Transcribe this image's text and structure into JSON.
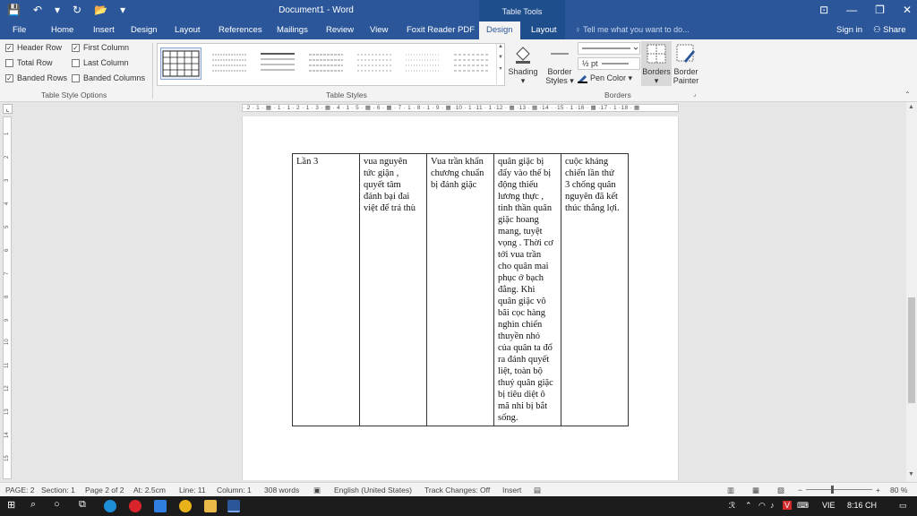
{
  "window": {
    "title": "Document1 - Word",
    "context_header": "Table Tools",
    "qat": [
      "💾",
      "↶",
      "▾",
      "↻",
      "📂",
      "▾"
    ],
    "controls": [
      "⊡",
      "—",
      "❐",
      "✕"
    ]
  },
  "tabs": [
    "File",
    "Home",
    "Insert",
    "Design",
    "Layout",
    "References",
    "Mailings",
    "Review",
    "View",
    "Foxit Reader PDF",
    "Design",
    "Layout"
  ],
  "active_tab_index": 10,
  "tell_me": "Tell me what you want to do...",
  "signin": "Sign in",
  "share": "Share",
  "style_options": {
    "items": [
      {
        "label": "Header Row",
        "checked": true
      },
      {
        "label": "First Column",
        "checked": true
      },
      {
        "label": "Total Row",
        "checked": false
      },
      {
        "label": "Last Column",
        "checked": false
      },
      {
        "label": "Banded Rows",
        "checked": true
      },
      {
        "label": "Banded Columns",
        "checked": false
      }
    ],
    "group_label": "Table Style Options"
  },
  "table_styles": {
    "group_label": "Table Styles"
  },
  "shading": {
    "label1": "Shading",
    "label2": "▾"
  },
  "border_styles": {
    "label1": "Border",
    "label2": "Styles ▾"
  },
  "pen_weight": "½ pt",
  "pen_color": "Pen Color ▾",
  "borders_btn": {
    "label1": "Borders",
    "label2": "▾"
  },
  "border_painter": {
    "label1": "Border",
    "label2": "Painter"
  },
  "borders_group_label": "Borders",
  "ruler_text": "· 2 · 1 · ▦ · 1 · 1 · 2 · 1 · 3 · ▦ · 4 · 1 · 5 · ▦ · 6 · ▦ · 7 · 1 · 8 · 1 · 9 · ▦ ·10 · 1 ·11 · 1 ·12 · ▦ ·13 · ▦ ·14 · ·15 · 1 ·16 · ▦ ·17 · 1 ·18 · ▦",
  "vruler_marks": [
    "1",
    "2",
    "3",
    "4",
    "5",
    "6",
    "7",
    "8",
    "9",
    "10",
    "11",
    "12",
    "13",
    "14",
    "15"
  ],
  "table_cells": [
    [
      "Lần 3"
    ],
    [
      "vua nguyên",
      "tức giận ,",
      "quyết tâm",
      "đánh bại đai",
      "việt để trả thù"
    ],
    [
      "Vua trần khẩn",
      "chương chuẩn",
      "bị đánh giặc"
    ],
    [
      "quân giặc bị",
      "đẩy vào thế bị",
      "động thiếu",
      "lương thực ,",
      "tinh thần quân",
      "giặc hoang",
      "mang, tuyệt",
      "vọng . Thời cơ",
      "tới vua trần",
      "cho quân mai",
      "phục ở bạch",
      "đằng. Khi",
      "quân giặc vô",
      "bãi cọc hàng",
      "nghìn chiến",
      "thuyền nhỏ",
      "của quân ta đổ",
      "ra đánh quyết",
      "liệt, toàn bộ",
      "thuỷ quân giặc",
      "bị tiêu diệt ô",
      "mã nhi bị bắt",
      "sống."
    ],
    [
      "cuộc kháng",
      "chiến lần thứ",
      "3 chống quân",
      "nguyên đã kết",
      "thúc thắng lợi."
    ]
  ],
  "status": {
    "page": "PAGE: 2",
    "section": "Section: 1",
    "page_of": "Page 2 of 2",
    "at": "At: 2.5cm",
    "line": "Line: 11",
    "column": "Column: 1",
    "words": "308 words",
    "language": "English (United States)",
    "track": "Track Changes: Off",
    "mode": "Insert",
    "zoom": "80 %"
  },
  "taskbar": {
    "lang": "VIE",
    "time": "8:16 CH"
  }
}
